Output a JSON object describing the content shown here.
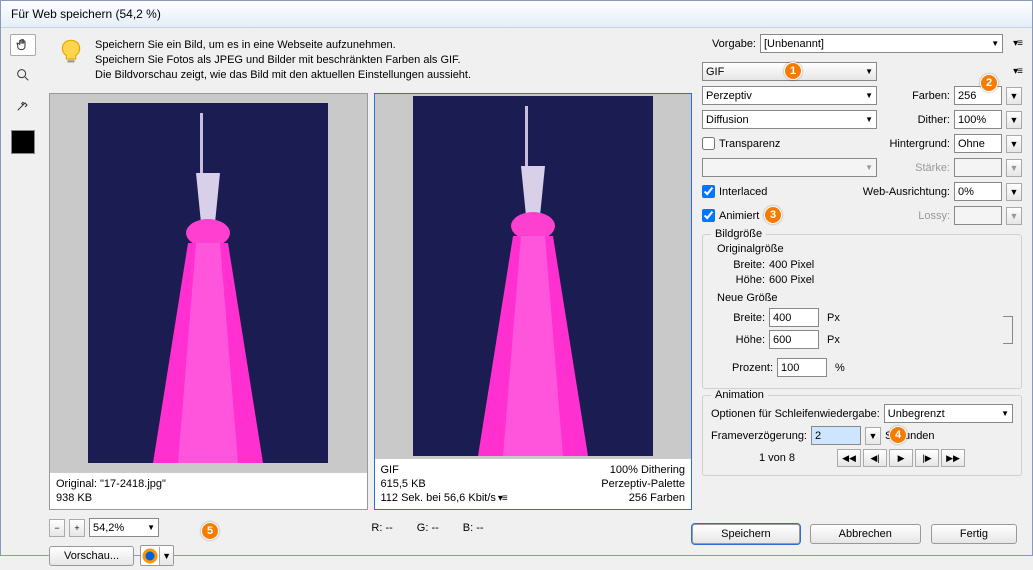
{
  "title": "Für Web speichern (54,2 %)",
  "hint": {
    "line1": "Speichern Sie ein Bild, um es in eine Webseite aufzunehmen.",
    "line2": "Speichern Sie Fotos als JPEG und Bilder mit beschränkten Farben als GIF.",
    "line3": "Die Bildvorschau zeigt, wie das Bild mit den aktuellen Einstellungen aussieht."
  },
  "left_meta": {
    "l1": "Original: \"17-2418.jpg\"",
    "l2": "938 KB"
  },
  "right_meta": {
    "l1a": "GIF",
    "l1b": "100% Dithering",
    "l2a": "615,5 KB",
    "l2b": "Perzeptiv-Palette",
    "l3a": "112 Sek. bei 56,6 Kbit/s",
    "l3b": "256 Farben"
  },
  "zoom": {
    "value": "54,2%"
  },
  "rgb": {
    "r": "R: --",
    "g": "G: --",
    "b": "B: --"
  },
  "preview_btn": "Vorschau...",
  "preset": {
    "label": "Vorgabe:",
    "value": "[Unbenannt]"
  },
  "format": "GIF",
  "reduction": "Perzeptiv",
  "colors": {
    "label": "Farben:",
    "value": "256"
  },
  "dither_method": "Diffusion",
  "dither": {
    "label": "Dither:",
    "value": "100%"
  },
  "transparency": "Transparenz",
  "matte": {
    "label": "Hintergrund:",
    "value": "Ohne"
  },
  "amount": {
    "label": "Stärke:"
  },
  "interlaced": "Interlaced",
  "webalign": {
    "label": "Web-Ausrichtung:",
    "value": "0%"
  },
  "animated": "Animiert",
  "lossy": {
    "label": "Lossy:"
  },
  "imgsize": {
    "title": "Bildgröße",
    "orig_title": "Originalgröße",
    "w_lbl": "Breite:",
    "w_val": "400 Pixel",
    "h_lbl": "Höhe:",
    "h_val": "600 Pixel",
    "new_title": "Neue Größe",
    "nw_lbl": "Breite:",
    "nw_val": "400",
    "px": "Px",
    "nh_lbl": "Höhe:",
    "nh_val": "600",
    "pct_lbl": "Prozent:",
    "pct_val": "100",
    "pct_unit": "%"
  },
  "anim": {
    "title": "Animation",
    "loop_lbl": "Optionen für Schleifenwiedergabe:",
    "loop_val": "Unbegrenzt",
    "delay_lbl": "Frameverzögerung:",
    "delay_val": "2",
    "delay_unit": "Sekunden",
    "pager": "1 von 8"
  },
  "buttons": {
    "save": "Speichern",
    "cancel": "Abbrechen",
    "done": "Fertig"
  },
  "badges": {
    "b1": "1",
    "b2": "2",
    "b3": "3",
    "b4": "4",
    "b5": "5"
  }
}
